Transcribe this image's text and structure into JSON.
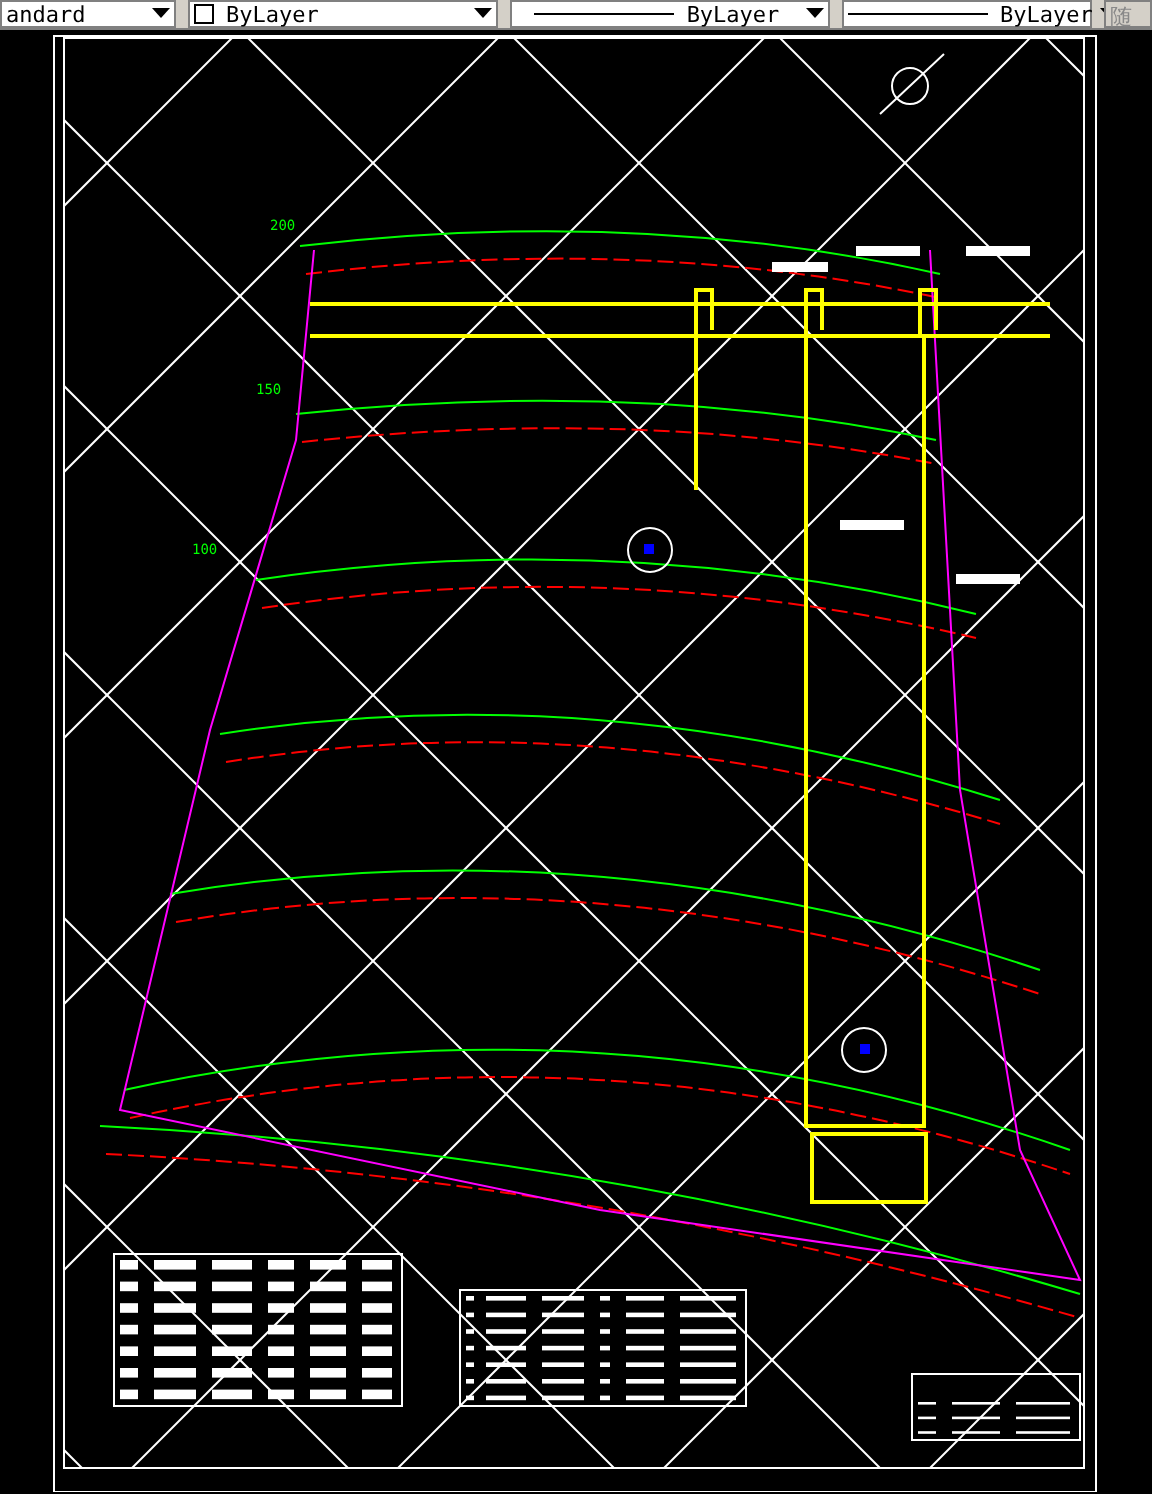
{
  "toolbar": {
    "combos": [
      {
        "kind": "text",
        "value": "andard"
      },
      {
        "kind": "color",
        "value": "ByLayer"
      },
      {
        "kind": "linetype",
        "value": "ByLayer"
      },
      {
        "kind": "lineweight",
        "value": "ByLayer"
      }
    ],
    "cut_button": "随"
  },
  "drawing": {
    "contour_labels": [
      "200",
      "150",
      "100"
    ]
  }
}
